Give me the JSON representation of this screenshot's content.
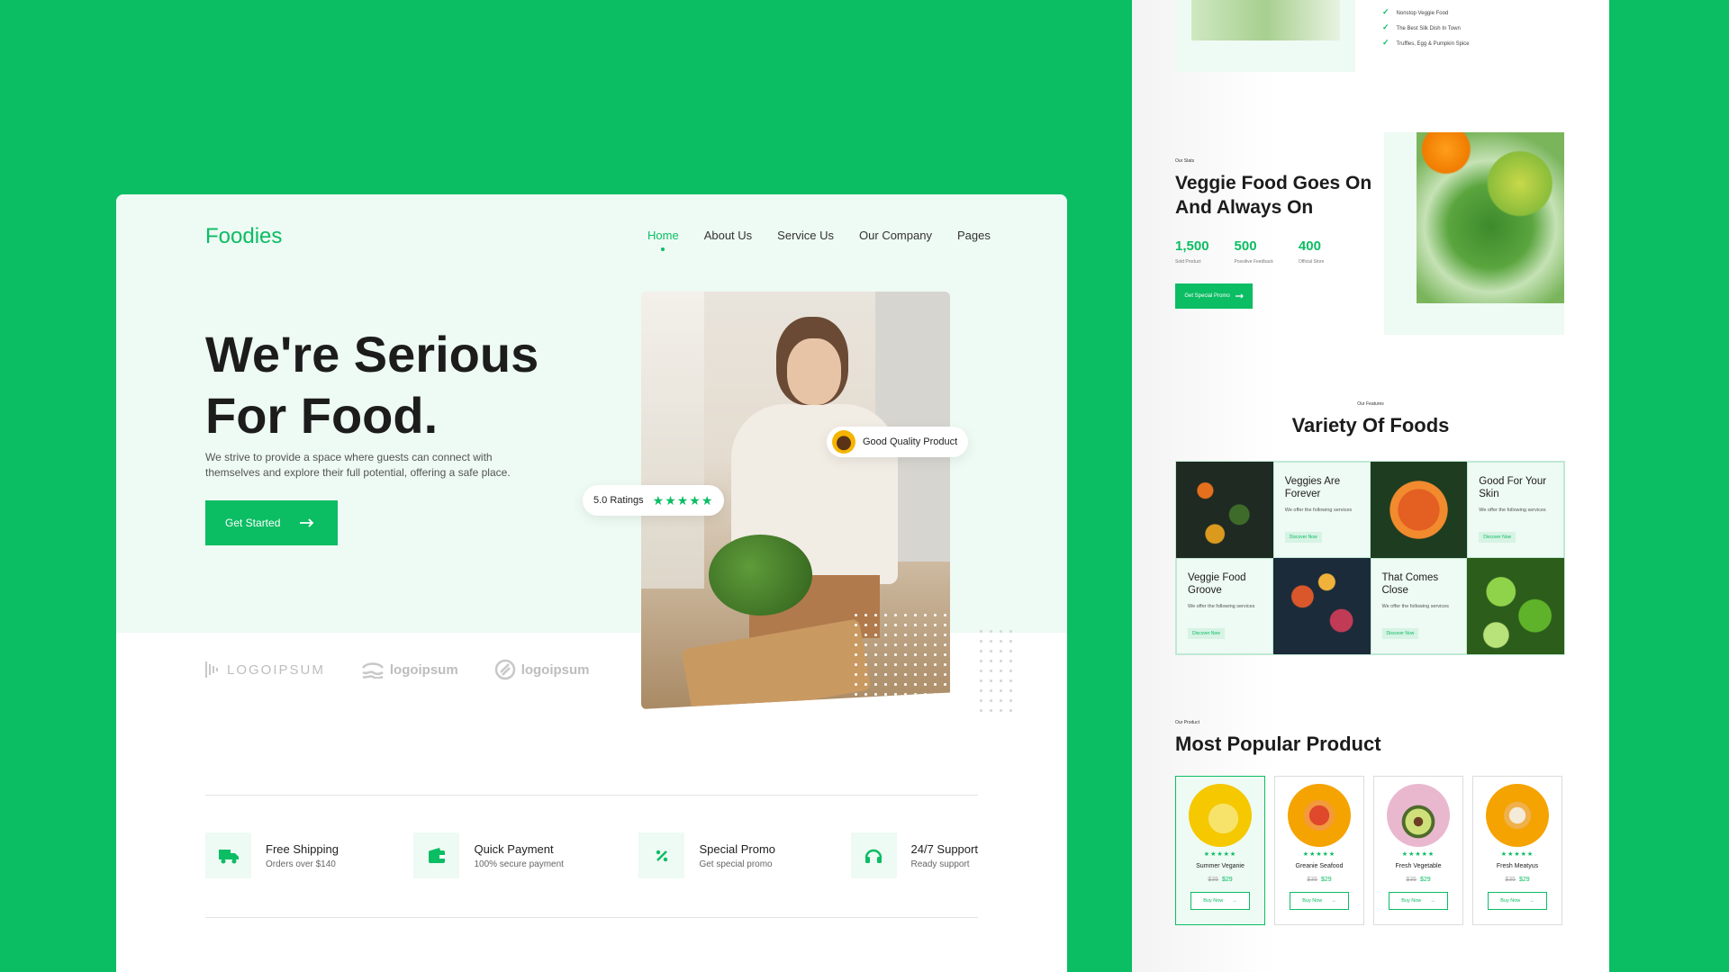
{
  "colors": {
    "accent": "#0bbd63",
    "hero_bg": "#eefaf4"
  },
  "left": {
    "logo": "Foodies",
    "nav": [
      {
        "label": "Home",
        "active": true
      },
      {
        "label": "About Us"
      },
      {
        "label": "Service Us"
      },
      {
        "label": "Our Company"
      },
      {
        "label": "Pages"
      }
    ],
    "hero": {
      "title_line1": "We're Serious",
      "title_line2": "For Food.",
      "description": "We strive to provide a space where guests can connect with themselves and explore their full potential, offering a safe place.",
      "cta_label": "Get Started"
    },
    "badges": {
      "quality": "Good Quality Product",
      "rating": "5.0 Ratings",
      "stars": "★★★★★"
    },
    "partners": [
      "LOGOIPSUM",
      "logoipsum",
      "logoipsum"
    ],
    "features": [
      {
        "icon": "truck-icon",
        "title": "Free Shipping",
        "subtitle": "Orders over $140"
      },
      {
        "icon": "wallet-icon",
        "title": "Quick Payment",
        "subtitle": "100% secure payment"
      },
      {
        "icon": "percent-icon",
        "title": "Special Promo",
        "subtitle": "Get special promo"
      },
      {
        "icon": "headphones-icon",
        "title": "24/7 Support",
        "subtitle": "Ready support"
      }
    ]
  },
  "right": {
    "checklist": [
      "Nonstop Veggie Food",
      "The Best Silk Dish In Town",
      "Truffles, Egg & Pumpkin Spice"
    ],
    "stats_section": {
      "eyebrow": "Our Stats",
      "title": "Veggie Food Goes On And Always On",
      "stats": [
        {
          "value": "1,500",
          "label": "Sold Product"
        },
        {
          "value": "500",
          "label": "Possitive Feedback"
        },
        {
          "value": "400",
          "label": "Official Store"
        }
      ],
      "cta_label": "Get Special Promo"
    },
    "variety": {
      "eyebrow": "Our Features",
      "title": "Variety Of Foods",
      "tiles": [
        {
          "title": "Veggies Are Forever",
          "desc": "We offer the following services",
          "cta": "Discover Now"
        },
        {
          "title": "Good For Your Skin",
          "desc": "We offer the following services",
          "cta": "Discover Now"
        },
        {
          "title": "Veggie Food Groove",
          "desc": "We offer the following services",
          "cta": "Discover Now"
        },
        {
          "title": "That Comes Close",
          "desc": "We offer the following services",
          "cta": "Discover Now"
        }
      ]
    },
    "popular": {
      "eyebrow": "Our Product",
      "title": "Most Popular Product",
      "products": [
        {
          "name": "Summer Veganie",
          "old_price": "$35",
          "price": "$29",
          "stars": "★★★★★",
          "cta": "Buy Now",
          "color": "#f5c800"
        },
        {
          "name": "Greanie Seafood",
          "old_price": "$35",
          "price": "$29",
          "stars": "★★★★★",
          "cta": "Buy Now",
          "color": "#f5a300"
        },
        {
          "name": "Fresh Vegetable",
          "old_price": "$35",
          "price": "$29",
          "stars": "★★★★★",
          "cta": "Buy Now",
          "color": "#e9b8cf"
        },
        {
          "name": "Fresh Meatyus",
          "old_price": "$35",
          "price": "$29",
          "stars": "★★★★★",
          "cta": "Buy Now",
          "color": "#f5a300"
        }
      ]
    }
  }
}
